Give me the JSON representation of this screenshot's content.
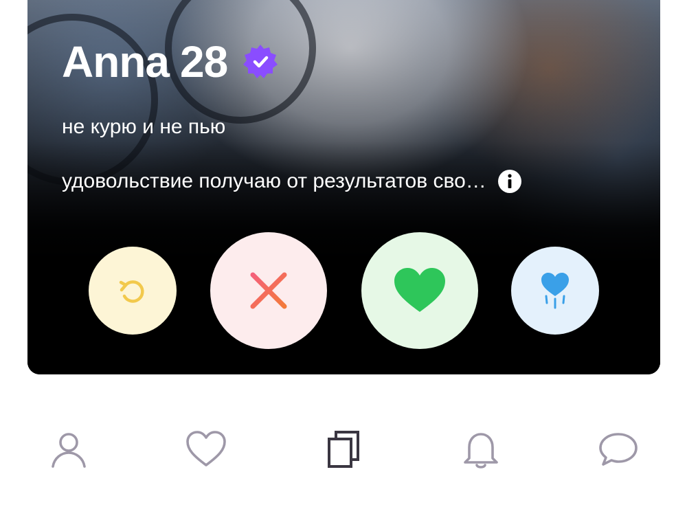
{
  "profile": {
    "name": "Anna",
    "age": "28",
    "line1": "не курю и не пью",
    "bio_preview": "удовольствие получаю от результатов сво…"
  },
  "icons": {
    "verified": "verified-badge-icon",
    "info": "info-icon",
    "undo": "undo-icon",
    "nope": "close-icon",
    "like": "heart-icon",
    "super": "super-like-icon"
  },
  "actions": [
    {
      "id": "undo",
      "color": "#f2c94c",
      "bg": "#fdf5d6"
    },
    {
      "id": "nope",
      "color": "#ef5a5a",
      "bg": "#fdeced"
    },
    {
      "id": "like",
      "color": "#2ec65a",
      "bg": "#e6f8e6"
    },
    {
      "id": "super",
      "color": "#3aa0e8",
      "bg": "#e4f1fc"
    }
  ],
  "tabbar": {
    "items": [
      {
        "icon": "profile-icon",
        "active": false
      },
      {
        "icon": "heart-outline-icon",
        "active": false
      },
      {
        "icon": "cards-icon",
        "active": true
      },
      {
        "icon": "bell-icon",
        "active": false
      },
      {
        "icon": "chat-bubble-icon",
        "active": false
      }
    ],
    "inactive_color": "#9e98a8",
    "active_color": "#3a3641"
  },
  "colors": {
    "verified": "#8a4dff"
  }
}
